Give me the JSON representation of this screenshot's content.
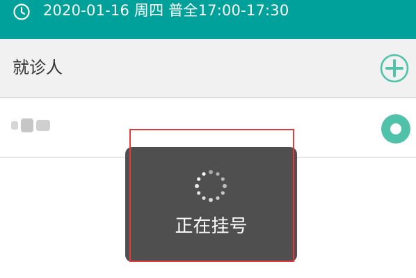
{
  "header": {
    "datetime_text": "2020-01-16 周四 普全17:00-17:30",
    "icon": "clock-icon",
    "background_color": "#00a19a"
  },
  "patient_section": {
    "label": "就诊人",
    "add_icon": "plus-circle-icon",
    "accent_color": "#4fc2a9"
  },
  "patients": [
    {
      "name": "",
      "selected": true
    }
  ],
  "loading_toast": {
    "message": "正在挂号",
    "icon": "spinner-icon",
    "background_color": "#4f4f4f"
  },
  "annotation": {
    "color": "#e53a3a"
  }
}
